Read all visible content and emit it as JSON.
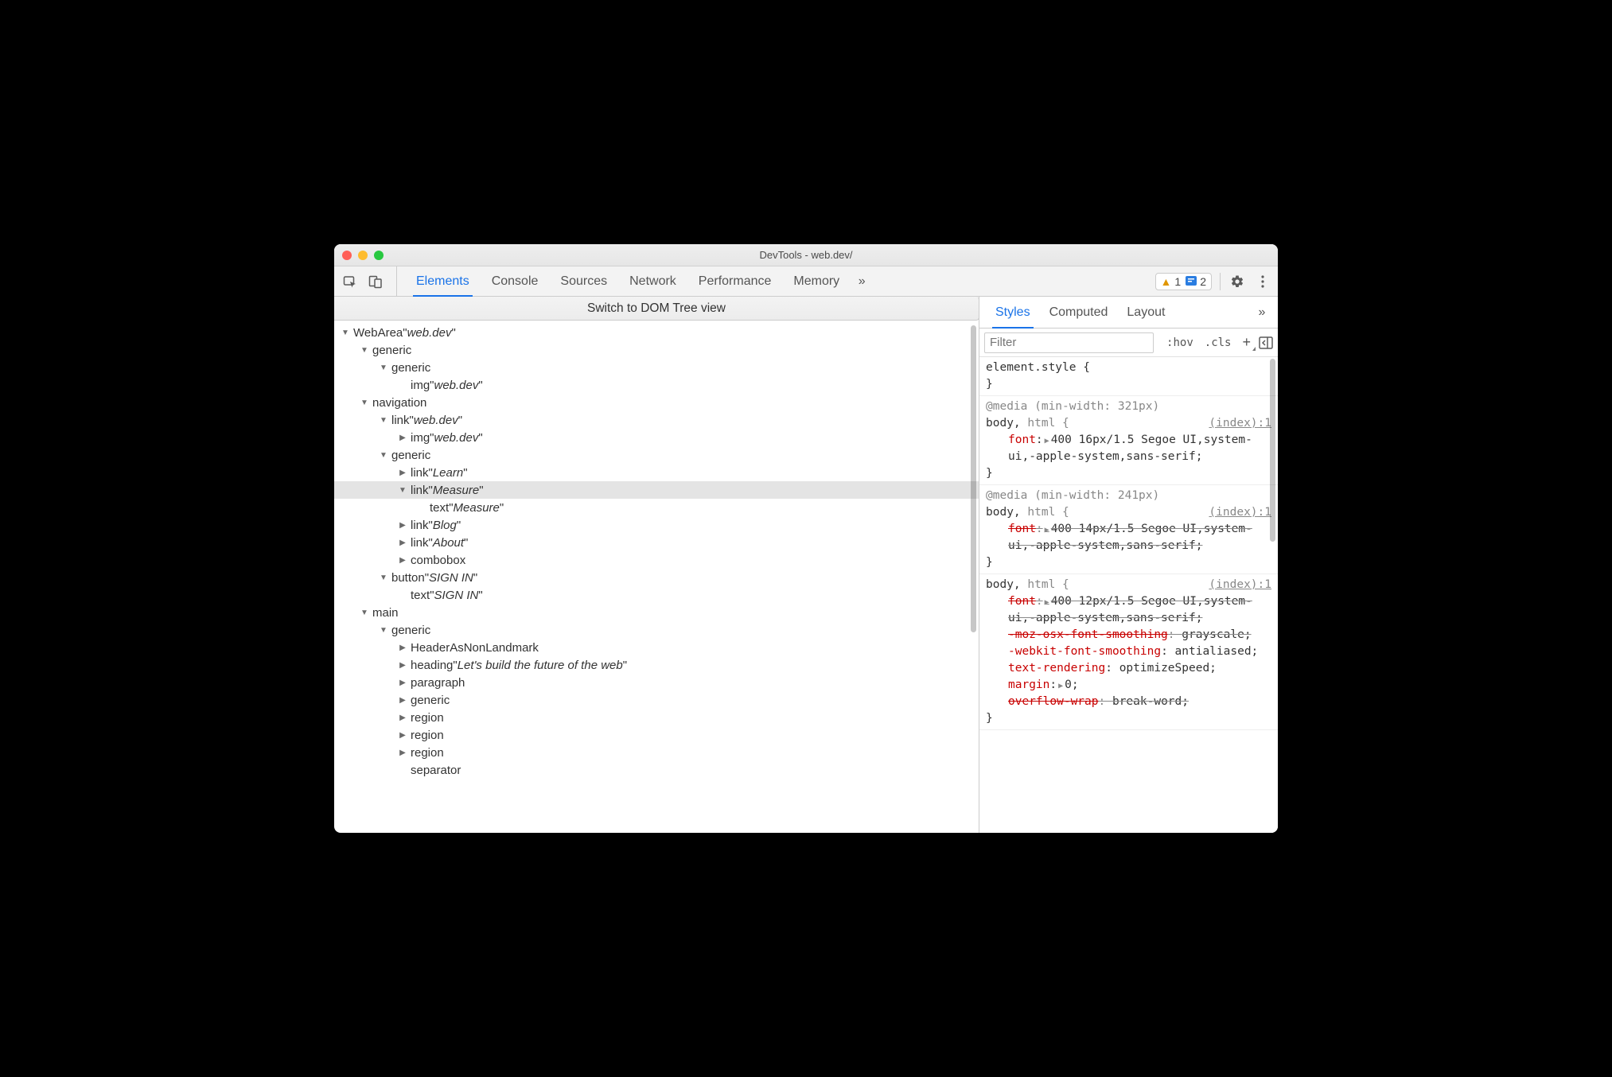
{
  "window_title": "DevTools - web.dev/",
  "toolbar": {
    "tabs": [
      "Elements",
      "Console",
      "Sources",
      "Network",
      "Performance",
      "Memory"
    ],
    "overflow": "»",
    "warn_count": "1",
    "info_count": "2"
  },
  "dom_switch_label": "Switch to DOM Tree view",
  "ax_tree": [
    {
      "indent": 0,
      "arrow": "down",
      "role": "WebArea",
      "name": "web.dev",
      "selected": false
    },
    {
      "indent": 1,
      "arrow": "down",
      "role": "generic",
      "name": null,
      "selected": false
    },
    {
      "indent": 2,
      "arrow": "down",
      "role": "generic",
      "name": null,
      "selected": false
    },
    {
      "indent": 3,
      "arrow": "blank",
      "role": "img",
      "name": "web.dev",
      "selected": false
    },
    {
      "indent": 1,
      "arrow": "down",
      "role": "navigation",
      "name": null,
      "selected": false
    },
    {
      "indent": 2,
      "arrow": "down",
      "role": "link",
      "name": "web.dev",
      "selected": false
    },
    {
      "indent": 3,
      "arrow": "right",
      "role": "img",
      "name": "web.dev",
      "selected": false
    },
    {
      "indent": 2,
      "arrow": "down",
      "role": "generic",
      "name": null,
      "selected": false
    },
    {
      "indent": 3,
      "arrow": "right",
      "role": "link",
      "name": "Learn",
      "selected": false
    },
    {
      "indent": 3,
      "arrow": "down",
      "role": "link",
      "name": "Measure",
      "selected": true
    },
    {
      "indent": 4,
      "arrow": "blank",
      "role": "text",
      "name": "Measure",
      "selected": false
    },
    {
      "indent": 3,
      "arrow": "right",
      "role": "link",
      "name": "Blog",
      "selected": false
    },
    {
      "indent": 3,
      "arrow": "right",
      "role": "link",
      "name": "About",
      "selected": false
    },
    {
      "indent": 3,
      "arrow": "right",
      "role": "combobox",
      "name": null,
      "selected": false
    },
    {
      "indent": 2,
      "arrow": "down",
      "role": "button",
      "name": "SIGN IN",
      "selected": false
    },
    {
      "indent": 3,
      "arrow": "blank",
      "role": "text",
      "name": "SIGN IN",
      "selected": false
    },
    {
      "indent": 1,
      "arrow": "down",
      "role": "main",
      "name": null,
      "selected": false
    },
    {
      "indent": 2,
      "arrow": "down",
      "role": "generic",
      "name": null,
      "selected": false
    },
    {
      "indent": 3,
      "arrow": "right",
      "role": "HeaderAsNonLandmark",
      "name": null,
      "selected": false
    },
    {
      "indent": 3,
      "arrow": "right",
      "role": "heading",
      "name": "Let's build the future of the web",
      "selected": false
    },
    {
      "indent": 3,
      "arrow": "right",
      "role": "paragraph",
      "name": null,
      "selected": false
    },
    {
      "indent": 3,
      "arrow": "right",
      "role": "generic",
      "name": null,
      "selected": false
    },
    {
      "indent": 3,
      "arrow": "right",
      "role": "region",
      "name": null,
      "selected": false
    },
    {
      "indent": 3,
      "arrow": "right",
      "role": "region",
      "name": null,
      "selected": false
    },
    {
      "indent": 3,
      "arrow": "right",
      "role": "region",
      "name": null,
      "selected": false
    },
    {
      "indent": 3,
      "arrow": "blank",
      "role": "separator",
      "name": null,
      "selected": false
    }
  ],
  "styles_panel": {
    "tabs": [
      "Styles",
      "Computed",
      "Layout"
    ],
    "overflow": "»",
    "filter_placeholder": "Filter",
    "hov": ":hov",
    "cls": ".cls",
    "element_style": "element.style {",
    "brace_close": "}",
    "rules": [
      {
        "media": "@media (min-width: 321px)",
        "selector_body": "body,",
        "selector_html": " html {",
        "source": "(index):1",
        "decls": [
          {
            "prop": "font",
            "tri": true,
            "val": "400 16px/1.5 Segoe UI,system-ui,-apple-system,sans-serif;",
            "strike": false
          }
        ]
      },
      {
        "media": "@media (min-width: 241px)",
        "selector_body": "body,",
        "selector_html": " html {",
        "source": "(index):1",
        "decls": [
          {
            "prop": "font",
            "tri": true,
            "val": "400 14px/1.5 Segoe UI,system-ui,-apple-system,sans-serif;",
            "strike": true
          }
        ]
      },
      {
        "media": null,
        "selector_body": "body,",
        "selector_html": " html {",
        "source": "(index):1",
        "decls": [
          {
            "prop": "font",
            "tri": true,
            "val": "400 12px/1.5 Segoe UI,system-ui,-apple-system,sans-serif;",
            "strike": true
          },
          {
            "prop": "-moz-osx-font-smoothing",
            "tri": false,
            "val": "grayscale;",
            "strike": true
          },
          {
            "prop": "-webkit-font-smoothing",
            "tri": false,
            "val": "antialiased;",
            "strike": false
          },
          {
            "prop": "text-rendering",
            "tri": false,
            "val": "optimizeSpeed;",
            "strike": false
          },
          {
            "prop": "margin",
            "tri": true,
            "val": "0;",
            "strike": false
          },
          {
            "prop": "overflow-wrap",
            "tri": false,
            "val": "break-word;",
            "strike": true
          }
        ]
      }
    ]
  }
}
